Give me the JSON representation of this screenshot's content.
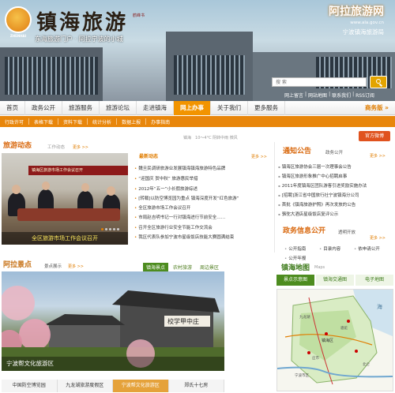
{
  "header": {
    "logo_text": "ZHENHAI",
    "calligraphy": "镇海旅游",
    "calligraphy_seal": "鹤峰书",
    "slogan": "东海旅游门户 · 阿拉宁波的小城",
    "brand_title": "阿拉旅游网",
    "brand_url": "www.alа.gov.cn",
    "brand_org": "宁波镇海旅游局",
    "search_placeholder": "搜 索",
    "quick_links": [
      "网上留言",
      "|",
      "网站地图",
      "|",
      "联系我们",
      "|",
      "RSS订阅"
    ]
  },
  "nav": {
    "items": [
      "首页",
      "政务公开",
      "旅游服务",
      "旅游论坛",
      "走进镇海",
      "网上办事",
      "关于我们",
      "更多服务"
    ],
    "active_index": 5,
    "more_label": "商务版 »"
  },
  "subnav": {
    "items": [
      "行政许可",
      "表格下载",
      "资料下载",
      "统计分析",
      "数据上报",
      "办事指南"
    ]
  },
  "official_button": "官方微博",
  "news": {
    "title": "旅游动态",
    "subtitle": "工作动态",
    "more": "更多 >>",
    "banner": "镇海区旅游市场工作会议召开",
    "caption": "全区旅游市场工作会议召开"
  },
  "latest": {
    "title": "最新动态",
    "more": "更多 >>",
    "weather_label": "镇海",
    "weather": "10～4°C 阴转中雨  微风",
    "items": [
      "魏旦民调研旅游业发展镇海镇海旅游特色品牌",
      "“迎国庆 贺中秋” 旅游惠民举措",
      "2012年“五一”小长假旅游综述",
      "[转载]以防空博览园为重点  镇海深度开发“红色旅游”",
      "全区旅游市场工作会议召开",
      "市局赵吉明书记一行对镇海进行节前安全……",
      "召开全区旅游行业安全节能工作交流会",
      "我区代表队参加宁波市星级饭店技能大赛圆满结束"
    ]
  },
  "notice": {
    "title": "通知公告",
    "subtitle": "政务公开",
    "more": "更多 >>",
    "items": [
      "镇海区旅游协会三届一次理事会公告",
      "镇海区旅游形象推广中心招聘启事",
      "2011年度镇海区团队游客引进奖励实施办法",
      "[招聘]浙江省中国旅行社宁波镇海分公司",
      "首批《镇海旅游护照》再次发放的公告",
      "骆驼大酒店星级饭店复评公示"
    ]
  },
  "gov": {
    "title": "政务信息公开",
    "subtitle": "透明开放",
    "more": "更多 >>",
    "items": [
      "公开指南",
      "目录内容",
      "依申请公开",
      "公开年报"
    ]
  },
  "scenic": {
    "title": "阿拉景点",
    "subtitle": "景点展示",
    "more": "更多 >>",
    "tabs": [
      "镇海景点",
      "农村旅游",
      "周边景区"
    ],
    "active_tab": 0,
    "caption": "宁波帮文化旅游区",
    "sign_text": "校学甲中庄",
    "thumbs": [
      "中国防空博览园",
      "九龙湖旅游度假区",
      "宁波帮文化旅游区",
      "郑氏十七房"
    ],
    "active_thumb": 2
  },
  "map": {
    "title": "镇海地图",
    "subtitle": "Maps",
    "tabs": [
      "景点示意图",
      "镇海交通图",
      "电子地图"
    ],
    "active_tab": 0,
    "sea_label": "海",
    "center_label": "镇海区",
    "labels": [
      "北仑",
      "宁波市区",
      "庄市",
      "骆驼",
      "九龙湖"
    ]
  },
  "colors": {
    "accent_orange": "#f29400",
    "subnav_orange": "#e8860b",
    "title_orange": "#d9690f",
    "green": "#4d8c1f"
  }
}
